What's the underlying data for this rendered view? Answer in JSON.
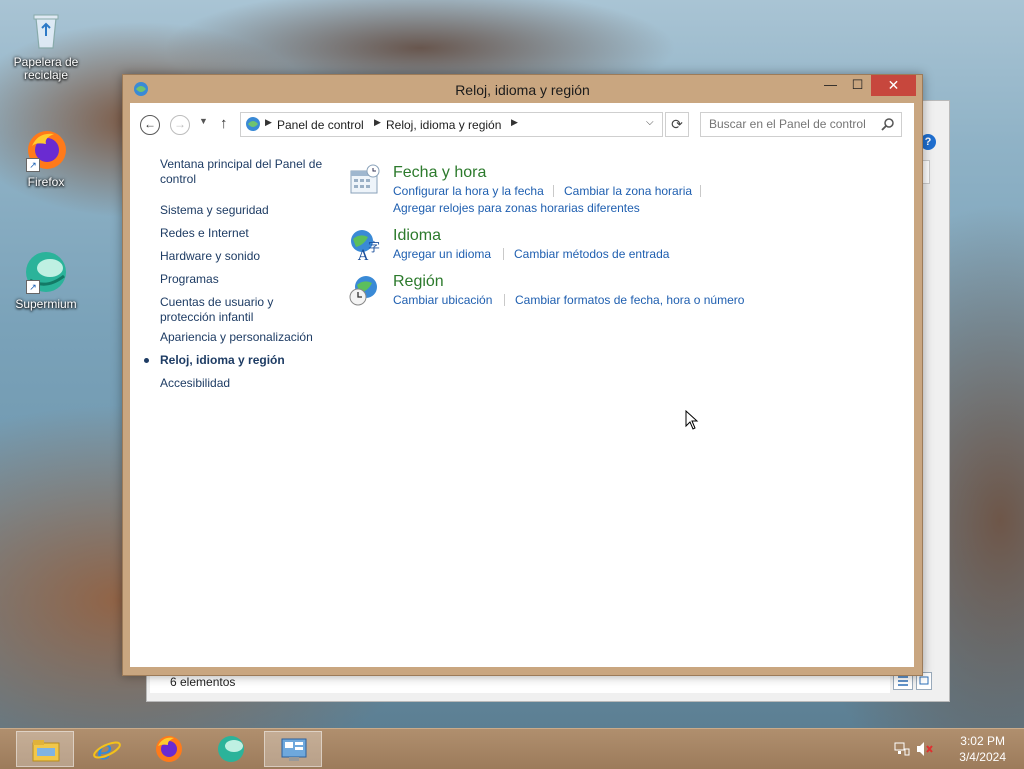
{
  "desktop": {
    "icons": [
      {
        "label": "Papelera de reciclaje",
        "icon": "recycle-bin-icon"
      },
      {
        "label": "Firefox",
        "icon": "firefox-icon"
      },
      {
        "label": "Supermium",
        "icon": "supermium-icon"
      }
    ]
  },
  "window": {
    "title": "Reloj, idioma y región",
    "breadcrumb": [
      "Panel de control",
      "Reloj, idioma y región"
    ],
    "search_placeholder": "Buscar en el Panel de control",
    "left_nav": [
      {
        "label": "Ventana principal del Panel de control",
        "current": false
      },
      {
        "label": "Sistema y seguridad",
        "current": false
      },
      {
        "label": "Redes e Internet",
        "current": false
      },
      {
        "label": "Hardware y sonido",
        "current": false
      },
      {
        "label": "Programas",
        "current": false
      },
      {
        "label": "Cuentas de usuario y protección infantil",
        "current": false
      },
      {
        "label": "Apariencia y personalización",
        "current": false
      },
      {
        "label": "Reloj, idioma y región",
        "current": true
      },
      {
        "label": "Accesibilidad",
        "current": false
      }
    ],
    "categories": [
      {
        "title": "Fecha y hora",
        "icon": "date-time-icon",
        "tasks": [
          "Configurar la hora y la fecha",
          "Cambiar la zona horaria",
          "Agregar relojes para zonas horarias diferentes"
        ]
      },
      {
        "title": "Idioma",
        "icon": "language-icon",
        "tasks": [
          "Agregar un idioma",
          "Cambiar métodos de entrada"
        ]
      },
      {
        "title": "Región",
        "icon": "region-icon",
        "tasks": [
          "Cambiar ubicación",
          "Cambiar formatos de fecha, hora o número"
        ]
      }
    ]
  },
  "back_window": {
    "status_text": "6 elementos"
  },
  "taskbar": {
    "apps": [
      "file-explorer-icon",
      "internet-explorer-icon",
      "firefox-icon",
      "supermium-icon",
      "control-panel-icon"
    ],
    "clock_time": "3:02 PM",
    "clock_date": "3/4/2024"
  },
  "colors": {
    "window_frame": "#c9a680",
    "close_button": "#c7473d",
    "link": "#1f5fb0",
    "category_title": "#2c7a2c",
    "nav_text": "#1e3c64"
  }
}
